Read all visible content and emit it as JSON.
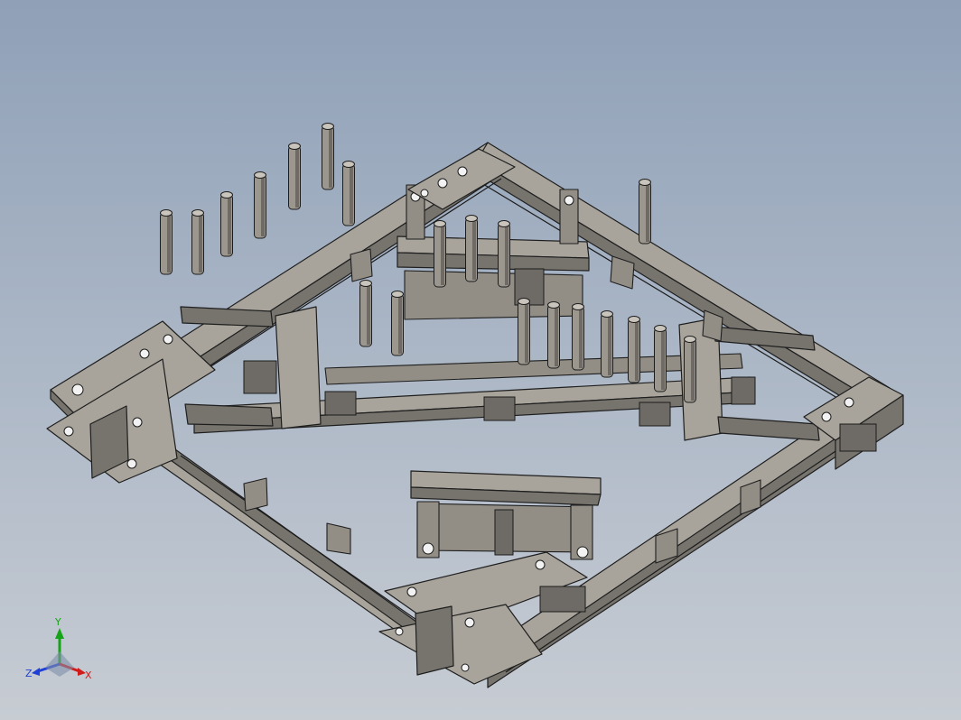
{
  "viewport": {
    "background_top": "#8fa0b7",
    "background_bottom": "#c7ccd3",
    "part_color": "#a8a49b",
    "edge_color": "#1e1e1e"
  },
  "model": {
    "pin_count": 20,
    "mounting_plate_count": 4
  },
  "triad": {
    "x_label": "X",
    "y_label": "Y",
    "z_label": "Z",
    "x_color": "#d11a1a",
    "y_color": "#17a317",
    "z_color": "#1f3fd6"
  }
}
